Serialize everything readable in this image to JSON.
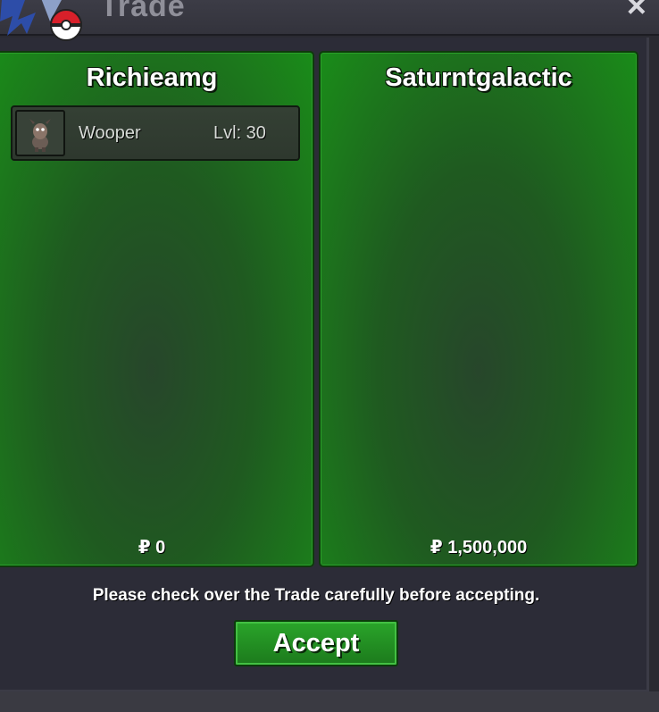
{
  "window": {
    "title": "Trade",
    "close_symbol": "×"
  },
  "left_panel": {
    "player_name": "Richieamg",
    "items": [
      {
        "name": "Wooper",
        "level": "Lvl: 30",
        "icon": "pokemon-sprite-icon"
      }
    ],
    "money": "₽ 0"
  },
  "right_panel": {
    "player_name": "Saturntgalactic",
    "items": [],
    "money": "₽ 1,500,000"
  },
  "footer": {
    "notice": "Please check over the Trade carefully before accepting.",
    "accept_label": "Accept"
  },
  "colors": {
    "panel_green": "#1a8c19",
    "button_green": "#2aa52a",
    "window_bg": "#2c2c37"
  }
}
